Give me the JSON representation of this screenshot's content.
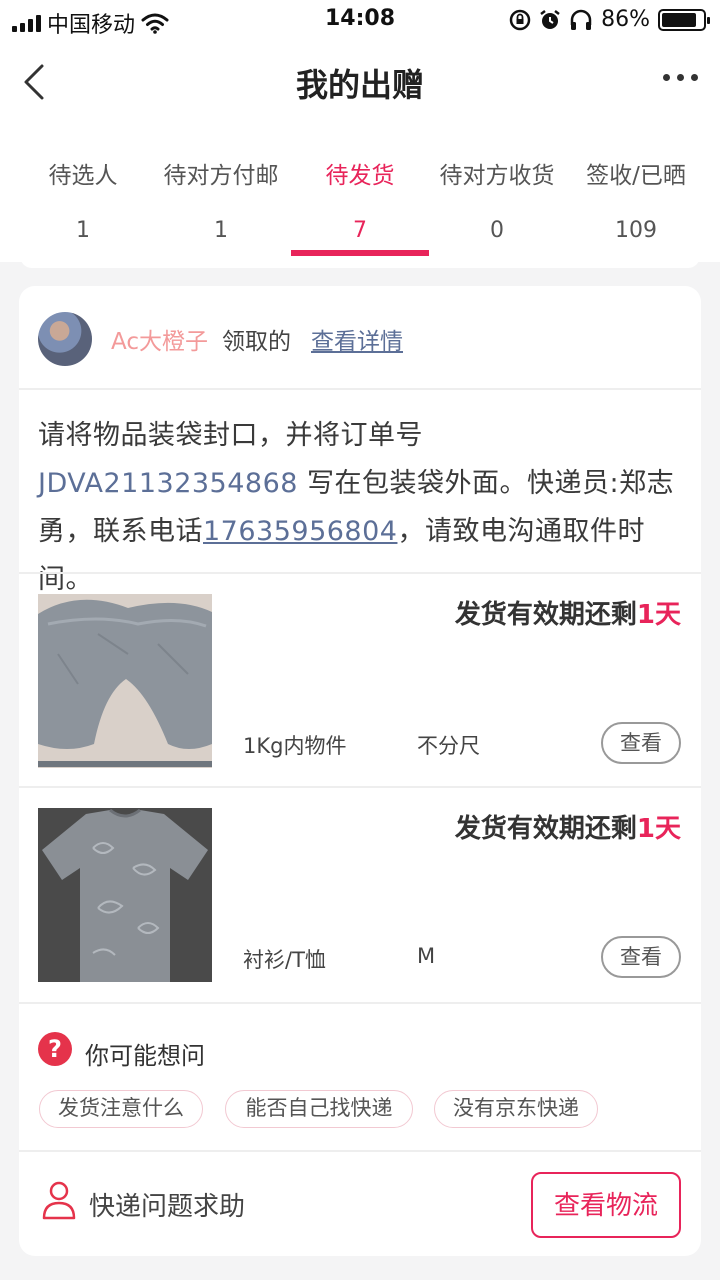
{
  "status_bar": {
    "carrier": "中国移动",
    "time": "14:08",
    "battery_percent": "86%",
    "battery_level": 0.86
  },
  "nav": {
    "title": "我的出赠"
  },
  "tabs": [
    {
      "label": "待选人",
      "count": "1"
    },
    {
      "label": "待对方付邮",
      "count": "1"
    },
    {
      "label": "待发货",
      "count": "7",
      "active": true
    },
    {
      "label": "待对方收货",
      "count": "0"
    },
    {
      "label": "签收/已晒",
      "count": "109"
    }
  ],
  "order": {
    "receiver_name": "Ac大橙子",
    "claimed_text": "领取的",
    "details_link": "查看详情",
    "notice": {
      "part1": "请将物品装袋封口，并将订单号 ",
      "order_no": "JDVA21132354868",
      "part2": " 写在包装袋外面。快递员:郑志勇，联系电话",
      "phone": "17635956804",
      "part3": "，请致电沟通取件时间。"
    },
    "items": [
      {
        "deadline_prefix": "发货有效期还剩",
        "deadline_days": "1天",
        "category": "1Kg内物件",
        "size": "不分尺",
        "view_label": "查看"
      },
      {
        "deadline_prefix": "发货有效期还剩",
        "deadline_days": "1天",
        "category": "衬衫/T恤",
        "size": "M",
        "view_label": "查看"
      }
    ],
    "faq": {
      "title": "你可能想问",
      "chips": [
        "发货注意什么",
        "能否自己找快递",
        "没有京东快递"
      ]
    },
    "help": {
      "label": "快递问题求助",
      "logistics_button": "查看物流"
    }
  },
  "colors": {
    "accent": "#e8245a",
    "link": "#5c6f97",
    "receiver_name": "#f39a9a"
  }
}
